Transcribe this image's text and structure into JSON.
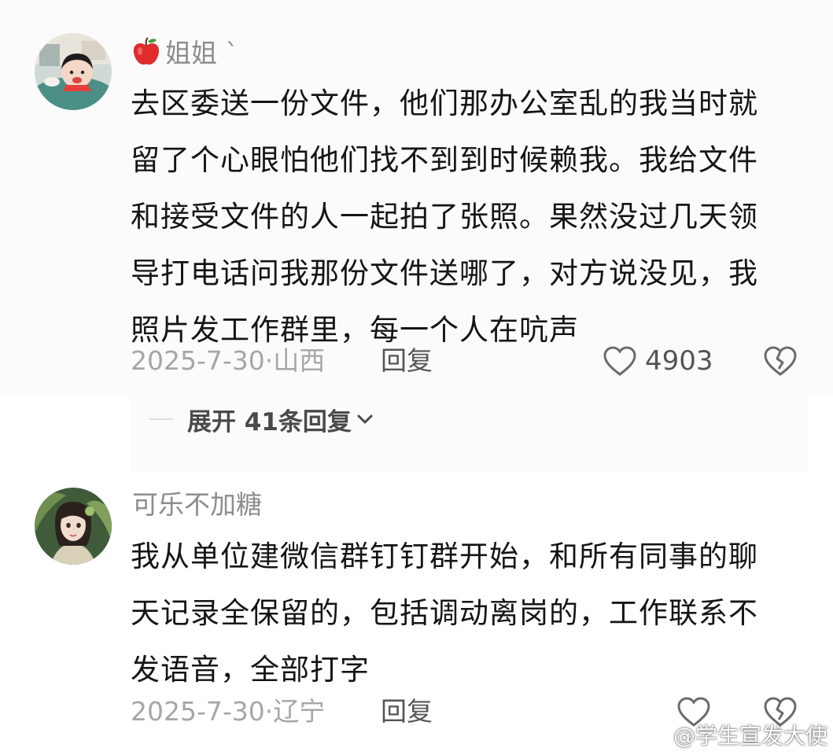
{
  "comments": [
    {
      "username": "姐姐 `",
      "user_badge_icon": "apple-icon",
      "content_lines": [
        "去区委送一份文件，他们那办公室乱的我当时就",
        "留了个心眼怕他们找不到到时候赖我。我给文件",
        "和接受文件的人一起拍了张照。果然没过几天领",
        "导打电话问我那份文件送哪了，对方说没见，我",
        "照片发工作群里，每一个人在吭声"
      ],
      "date": "2025-7-30",
      "location_separator": "·",
      "location": "山西",
      "reply_label": "回复",
      "like_count": "4903"
    },
    {
      "username": "可乐不加糖",
      "content_lines": [
        "我从单位建微信群钉钉群开始，和所有同事的聊",
        "天记录全保留的，包括调动离岗的，工作联系不",
        "发语音，全部打字"
      ],
      "date": "2025-7-30",
      "location_separator": "·",
      "location": "辽宁",
      "reply_label": "回复",
      "like_count": ""
    }
  ],
  "expand_replies": {
    "label": "展开 41条回复",
    "icon": "chevron-down-icon"
  },
  "watermark": {
    "text": "@学生宣发大使",
    "icon": "weibo-logo-icon"
  },
  "colors": {
    "text_primary": "#151515",
    "text_secondary": "#8c8c8c",
    "meta": "#a6a6a6",
    "background_highlight": "#fbfbfb"
  }
}
